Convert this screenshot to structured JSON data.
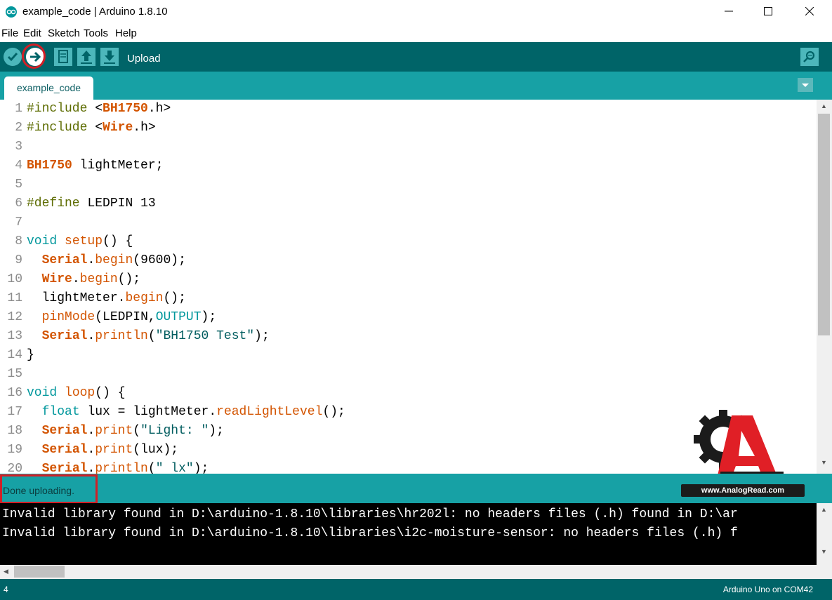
{
  "window": {
    "title": "example_code | Arduino 1.8.10"
  },
  "menu": [
    "File",
    "Edit",
    "Sketch",
    "Tools",
    "Help"
  ],
  "toolbar": {
    "hover_label": "Upload",
    "buttons": [
      "verify-icon",
      "upload-icon",
      "new-icon",
      "open-icon",
      "save-icon",
      "serial-monitor-icon"
    ]
  },
  "tab": {
    "label": "example_code"
  },
  "colors": {
    "teal_dark": "#006468",
    "teal": "#17a1a5",
    "keyword_orange": "#d35400",
    "type_teal": "#00979c",
    "number": "#000000",
    "string": "#005c5f",
    "highlight_red": "#d21f26"
  },
  "code": [
    {
      "n": "1",
      "text": "#include <BH1750.h>"
    },
    {
      "n": "2",
      "text": "#include <Wire.h>"
    },
    {
      "n": "3",
      "text": ""
    },
    {
      "n": "4",
      "text": "BH1750 lightMeter;"
    },
    {
      "n": "5",
      "text": ""
    },
    {
      "n": "6",
      "text": "#define LEDPIN 13"
    },
    {
      "n": "7",
      "text": ""
    },
    {
      "n": "8",
      "text": "void setup() {"
    },
    {
      "n": "9",
      "text": "  Serial.begin(9600);"
    },
    {
      "n": "10",
      "text": "  Wire.begin();"
    },
    {
      "n": "11",
      "text": "  lightMeter.begin();"
    },
    {
      "n": "12",
      "text": "  pinMode(LEDPIN,OUTPUT);"
    },
    {
      "n": "13",
      "text": "  Serial.println(\"BH1750 Test\");"
    },
    {
      "n": "14",
      "text": "}"
    },
    {
      "n": "15",
      "text": ""
    },
    {
      "n": "16",
      "text": "void loop() {"
    },
    {
      "n": "17",
      "text": "  float lux = lightMeter.readLightLevel();"
    },
    {
      "n": "18",
      "text": "  Serial.print(\"Light: \");"
    },
    {
      "n": "19",
      "text": "  Serial.print(lux);"
    },
    {
      "n": "20",
      "text": "  Serial.println(\" lx\");"
    }
  ],
  "status": {
    "message": "Done uploading."
  },
  "console": [
    "Invalid library found in D:\\arduino-1.8.10\\libraries\\hr202l: no headers files (.h) found in D:\\ar",
    "Invalid library found in D:\\arduino-1.8.10\\libraries\\i2c-moisture-sensor: no headers files (.h) f"
  ],
  "footer": {
    "line": "4",
    "board": "Arduino Uno on COM42"
  },
  "watermark": {
    "url": "www.AnalogRead.com"
  }
}
